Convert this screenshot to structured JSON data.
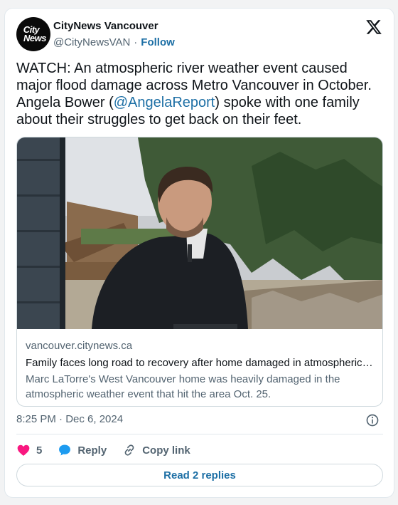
{
  "account": {
    "avatar_line1": "City",
    "avatar_line2": "News",
    "name": "CityNews Vancouver",
    "handle": "@CityNewsVAN",
    "separator": "·",
    "follow_label": "Follow"
  },
  "tweet": {
    "text_before": "WATCH: An atmospheric river weather event caused major flood damage across Metro Vancouver in October. Angela Bower (",
    "mention": "@AngelaReport",
    "text_after": ") spoke with one family about their struggles to get back on their feet."
  },
  "link_card": {
    "domain": "vancouver.citynews.ca",
    "headline": "Family faces long road to recovery after home damaged in atmospheric river",
    "description": "Marc LaTorre's West Vancouver home was heavily damaged in the atmospheric weather event that hit the area Oct. 25."
  },
  "meta": {
    "timestamp": "8:25 PM · Dec 6, 2024"
  },
  "actions": {
    "like_count": "5",
    "reply_label": "Reply",
    "copy_link_label": "Copy link"
  },
  "read_replies_label": "Read 2 replies",
  "icons": {
    "x_logo": "x-logo-icon",
    "info": "info-icon",
    "like": "heart-icon",
    "reply": "speech-bubble-icon",
    "copy": "link-icon"
  },
  "colors": {
    "link": "#1d6fa5",
    "like": "#f91880",
    "reply": "#1d9bf0",
    "muted": "#536471"
  }
}
